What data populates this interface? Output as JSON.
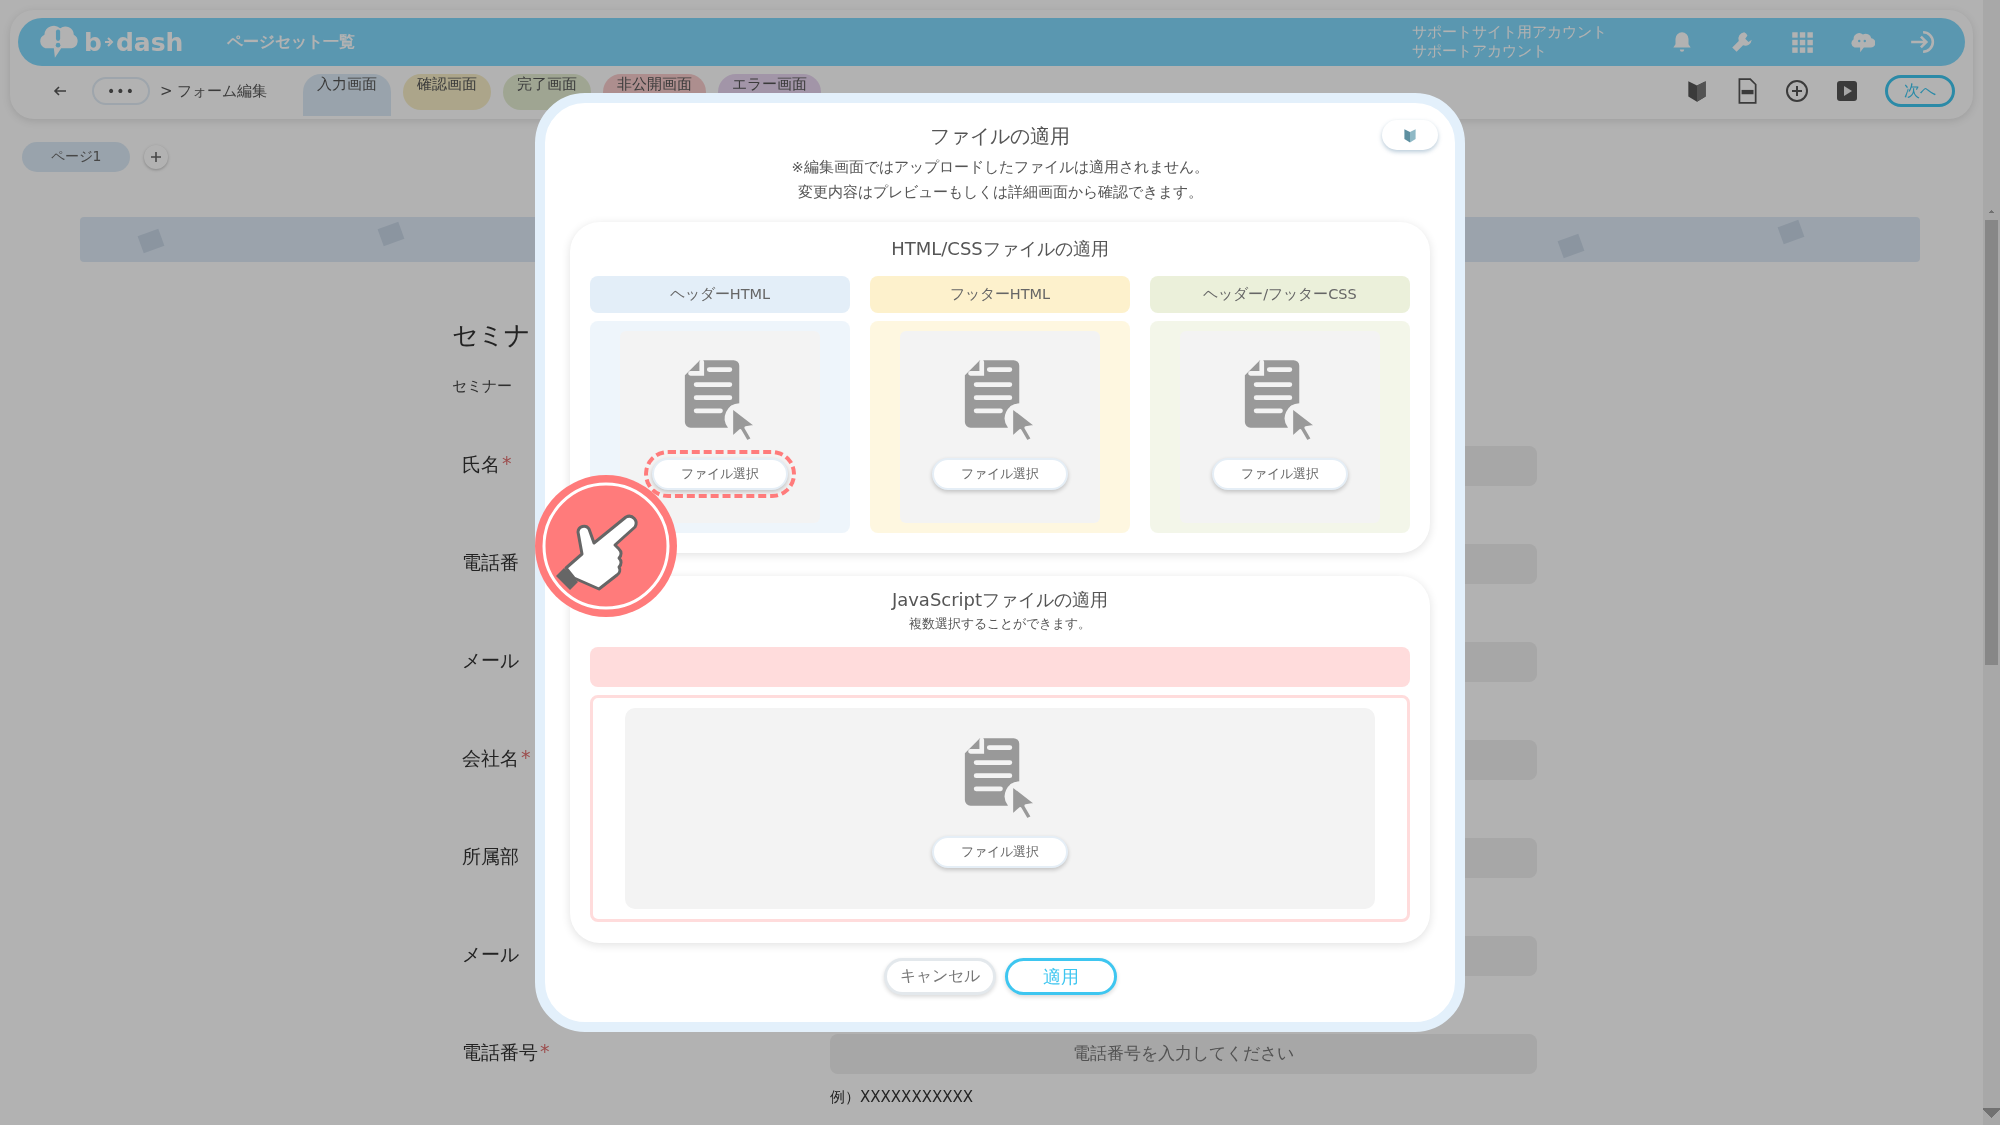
{
  "app_bar": {
    "logo": [
      "b",
      "dash"
    ],
    "title": "ページセット一覧",
    "account_lines": [
      "サポートサイト用アカウント",
      "サポートアカウント"
    ]
  },
  "toolbar": {
    "more": "•••",
    "breadcrumb": "> フォーム編集",
    "tabs": [
      {
        "label": "入力画面",
        "selected": true
      },
      {
        "label": "確認画面",
        "selected": false
      },
      {
        "label": "完了画面",
        "selected": false
      },
      {
        "label": "非公開画面",
        "selected": false
      },
      {
        "label": "エラー画面",
        "selected": false
      }
    ],
    "next": "次へ"
  },
  "page_tabs": [
    "ページ1"
  ],
  "form": {
    "title": "セミナ",
    "intro": "セミナー",
    "fields": [
      {
        "label": "氏名",
        "required_mark": "*"
      },
      {
        "label": "電話番"
      },
      {
        "label": "メール"
      },
      {
        "label": "会社名",
        "required_mark": "*"
      },
      {
        "label": "所属部"
      },
      {
        "label": "メール"
      },
      {
        "label": "電話番号",
        "required_mark": "*",
        "placeholder": "電話番号を入力してください",
        "example": "例）XXXXXXXXXXX"
      }
    ]
  },
  "modal": {
    "title": "ファイルの適用",
    "notes": [
      "※編集画面ではアップロードしたファイルは適用されません。",
      "変更内容はプレビューもしくは詳細画面から確認できます。"
    ],
    "html_section": {
      "title": "HTML/CSSファイルの適用",
      "slots": [
        {
          "label": "ヘッダーHTML",
          "color": "#e3eef8",
          "button": "ファイル選択",
          "highlighted": true
        },
        {
          "label": "フッターHTML",
          "color": "#fdf1cc",
          "button": "ファイル選択",
          "highlighted": false
        },
        {
          "label": "ヘッダー/フッターCSS",
          "color": "#ebf0da",
          "button": "ファイル選択",
          "highlighted": false
        }
      ]
    },
    "js_section": {
      "title": "JavaScriptファイルの適用",
      "subtitle": "複数選択することができます。",
      "button": "ファイル選択"
    },
    "buttons": [
      {
        "label": "キャンセル",
        "kind": "secondary"
      },
      {
        "label": "適用",
        "kind": "primary"
      }
    ]
  }
}
